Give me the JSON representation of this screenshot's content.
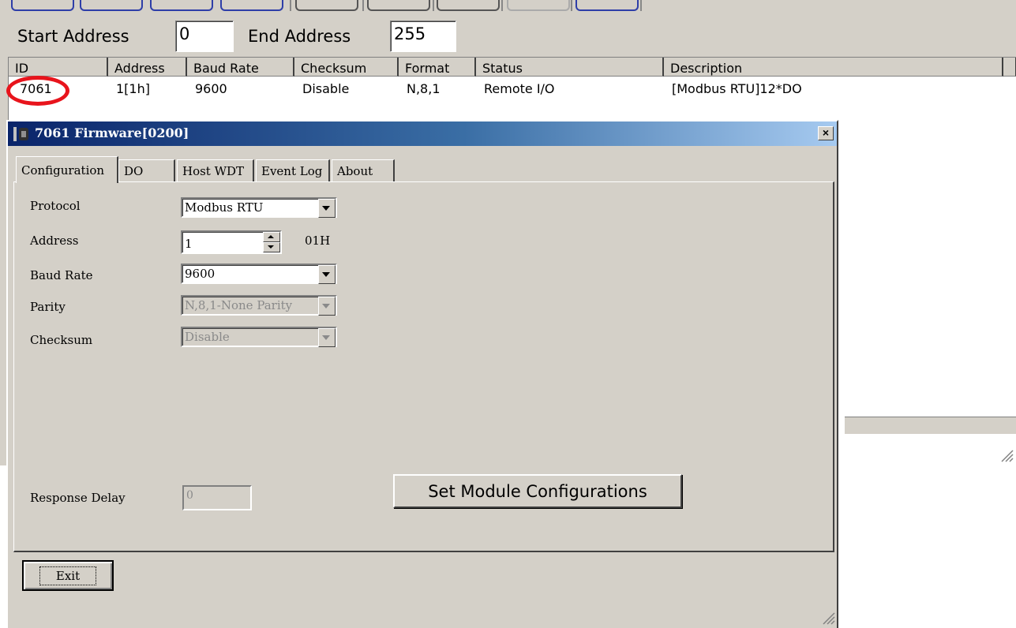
{
  "scan": {
    "start_label": "Start Address",
    "start_value": "0",
    "end_label": "End Address",
    "end_value": "255"
  },
  "list": {
    "headers": [
      "ID",
      "Address",
      "Baud Rate",
      "Checksum",
      "Format",
      "Status",
      "Description"
    ],
    "rows": [
      [
        "7061",
        "1[1h]",
        "9600",
        "Disable",
        "N,8,1",
        "Remote I/O",
        "[Modbus RTU]12*DO"
      ]
    ]
  },
  "dialog": {
    "title": "7061 Firmware[0200]",
    "close_label": "×",
    "tabs": [
      "Configuration",
      "DO",
      "Host WDT",
      "Event Log",
      "About"
    ],
    "active_tab": "Configuration",
    "fields": {
      "protocol_label": "Protocol",
      "protocol_value": "Modbus RTU",
      "address_label": "Address",
      "address_value": "1",
      "address_hex": "01H",
      "baud_label": "Baud Rate",
      "baud_value": "9600",
      "parity_label": "Parity",
      "parity_value": "N,8,1-None Parity",
      "checksum_label": "Checksum",
      "checksum_value": "Disable",
      "response_delay_label": "Response Delay",
      "response_delay_value": "0"
    },
    "set_button": "Set Module Configurations",
    "exit_button": "Exit"
  },
  "icons": {
    "dialog_icon": "device-icon",
    "highlight": "red-circle-annotation"
  },
  "colors": {
    "titlebar_start": "#0a246a",
    "titlebar_end": "#a6caf0",
    "highlight": "#e8141c",
    "window_bg": "#d4d0c8"
  }
}
